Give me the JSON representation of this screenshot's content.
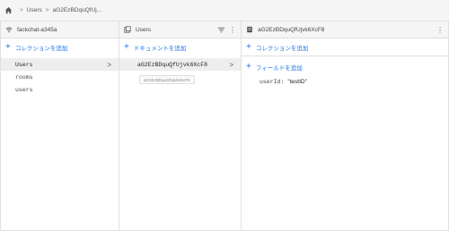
{
  "breadcrumb": {
    "items": [
      "Users",
      "aG2EzBDquQfUj..."
    ],
    "separator": ">"
  },
  "panels": {
    "root": {
      "title": "fackchat-a345a",
      "add_label": "コレクションを追加",
      "items": [
        {
          "label": "Users",
          "selected": true
        },
        {
          "label": "rooms",
          "selected": false
        },
        {
          "label": "users",
          "selected": false
        }
      ]
    },
    "collection": {
      "title": "Users",
      "add_label": "ドキュメントを追加",
      "document": "aG2EzBDquQfUjvk6XcF8",
      "chip": "aG2EzBDquQfUjvk6XcF8"
    },
    "document": {
      "title": "aG2EzBDquQfUjvk6XcF8",
      "add_collection_label": "コレクションを追加",
      "add_field_label": "フィールドを追加",
      "field_key": "userId:",
      "field_value": "\"testID\""
    }
  },
  "icons": {
    "home": "home-icon",
    "root": "database-icon",
    "collection": "collection-icon",
    "document": "document-icon",
    "filter": "filter-icon",
    "more": "more-vert-icon",
    "chevron": "chevron-right-icon",
    "plus": "plus-icon"
  },
  "colors": {
    "accent": "#1a73e8",
    "header_bg": "#f5f5f5",
    "selected_bg": "#eeeeee"
  }
}
